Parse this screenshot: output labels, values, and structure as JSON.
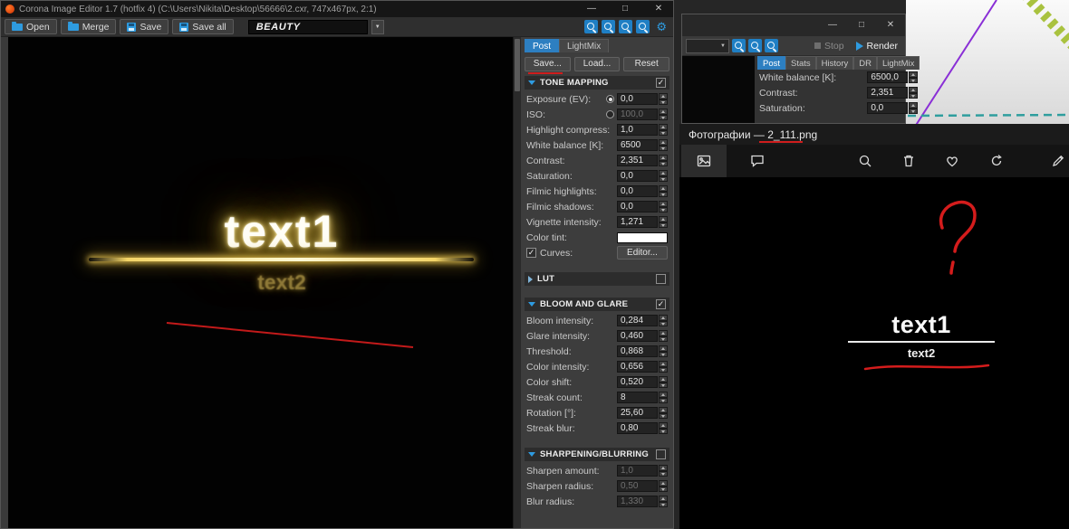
{
  "icons": {
    "minimize": "—",
    "maximize": "□",
    "close": "✕",
    "dropdown_arrow": "▼",
    "gear": "⚙"
  },
  "colors": {
    "accent_blue": "#2e9be0",
    "tab_active_blue": "#2d7fc1",
    "glow_yellow": "#ffe27a",
    "annotation_red": "#cf1d1d"
  },
  "editor_window": {
    "title": "Corona Image Editor 1.7 (hotfix 4) (C:\\Users\\Nikita\\Desktop\\56666\\2.cxr, 747x467px, 2:1)",
    "toolbar": {
      "open": "Open",
      "merge": "Merge",
      "save": "Save",
      "save_all": "Save all",
      "channel": "BEAUTY"
    },
    "canvas": {
      "text1": "text1",
      "text2": "text2"
    },
    "panel": {
      "tabs": [
        {
          "label": "Post",
          "active": true
        },
        {
          "label": "LightMix"
        }
      ],
      "save": "Save...",
      "load": "Load...",
      "reset": "Reset",
      "tone_mapping": {
        "title": "TONE MAPPING",
        "enabled": true,
        "rows": [
          {
            "label": "Exposure (EV):",
            "value": "0,0",
            "radio": "selected"
          },
          {
            "label": "ISO:",
            "value": "100,0",
            "radio": "unselected",
            "disabled": true
          },
          {
            "label": "Highlight compress:",
            "value": "1,0"
          },
          {
            "label": "White balance [K]:",
            "value": "6500"
          },
          {
            "label": "Contrast:",
            "value": "2,351"
          },
          {
            "label": "Saturation:",
            "value": "0,0"
          },
          {
            "label": "Filmic highlights:",
            "value": "0,0"
          },
          {
            "label": "Filmic shadows:",
            "value": "0,0"
          },
          {
            "label": "Vignette intensity:",
            "value": "1,271"
          }
        ],
        "color_tint_label": "Color tint:",
        "curves_label": "Curves:",
        "curves_checked": true,
        "editor_button": "Editor..."
      },
      "lut": {
        "title": "LUT",
        "enabled": false
      },
      "bloom_glare": {
        "title": "BLOOM AND GLARE",
        "enabled": true,
        "rows": [
          {
            "label": "Bloom intensity:",
            "value": "0,284"
          },
          {
            "label": "Glare intensity:",
            "value": "0,460"
          },
          {
            "label": "Threshold:",
            "value": "0,868"
          },
          {
            "label": "Color intensity:",
            "value": "0,656"
          },
          {
            "label": "Color shift:",
            "value": "0,520"
          },
          {
            "label": "Streak count:",
            "value": "8"
          },
          {
            "label": "Rotation [°]:",
            "value": "25,60"
          },
          {
            "label": "Streak blur:",
            "value": "0,80"
          }
        ]
      },
      "sharpening": {
        "title": "SHARPENING/BLURRING",
        "enabled": false,
        "rows": [
          {
            "label": "Sharpen amount:",
            "value": "1,0",
            "disabled": true
          },
          {
            "label": "Sharpen radius:",
            "value": "0,50",
            "disabled": true
          },
          {
            "label": "Blur radius:",
            "value": "1,330",
            "disabled": true
          }
        ]
      }
    }
  },
  "vfb_window": {
    "stop_label": "Stop",
    "render_label": "Render",
    "tabs": [
      {
        "label": "Post",
        "active": true
      },
      {
        "label": "Stats"
      },
      {
        "label": "History"
      },
      {
        "label": "DR"
      },
      {
        "label": "LightMix"
      }
    ],
    "rows": [
      {
        "label": "White balance [K]:",
        "value": "6500,0"
      },
      {
        "label": "Contrast:",
        "value": "2,351"
      },
      {
        "label": "Saturation:",
        "value": "0,0"
      }
    ]
  },
  "photos_window": {
    "title": "Фотографии — 2_111.png",
    "text1": "text1",
    "text2": "text2"
  }
}
